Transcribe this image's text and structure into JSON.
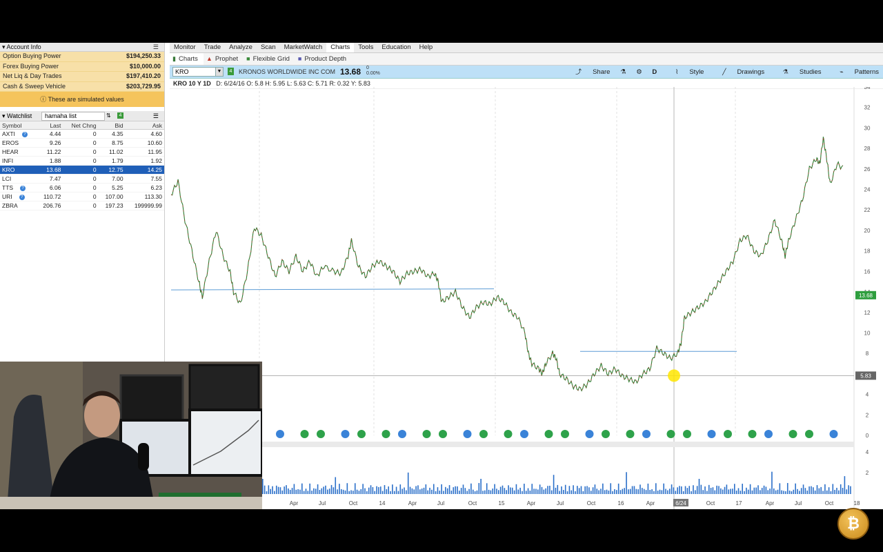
{
  "account": {
    "header": "Account Info",
    "rows": [
      {
        "label": "Option Buying Power",
        "value": "$194,250.33"
      },
      {
        "label": "Forex Buying Power",
        "value": "$10,000.00"
      },
      {
        "label": "Net Liq & Day Trades",
        "value": "$197,410.20"
      },
      {
        "label": "Cash & Sweep Vehicle",
        "value": "$203,729.95"
      }
    ],
    "sim_notice": "These are simulated values"
  },
  "watchlist": {
    "header": "Watchlist",
    "list_name": "hamaha list",
    "columns": [
      "Symbol",
      "Last",
      "Net Chng",
      "Bid",
      "Ask"
    ],
    "rows": [
      {
        "symbol": "AXTI",
        "last": "4.44",
        "chg": "0",
        "bid": "4.35",
        "ask": "4.60",
        "info": true
      },
      {
        "symbol": "EROS",
        "last": "9.26",
        "chg": "0",
        "bid": "8.75",
        "ask": "10.60",
        "info": false
      },
      {
        "symbol": "HEAR",
        "last": "11.22",
        "chg": "0",
        "bid": "11.02",
        "ask": "11.95",
        "info": false
      },
      {
        "symbol": "INFI",
        "last": "1.88",
        "chg": "0",
        "bid": "1.79",
        "ask": "1.92",
        "info": false
      },
      {
        "symbol": "KRO",
        "last": "13.68",
        "chg": "0",
        "bid": "12.75",
        "ask": "14.25",
        "info": false,
        "selected": true
      },
      {
        "symbol": "LCI",
        "last": "7.47",
        "chg": "0",
        "bid": "7.00",
        "ask": "7.55",
        "info": false
      },
      {
        "symbol": "TTS",
        "last": "6.06",
        "chg": "0",
        "bid": "5.25",
        "ask": "6.23",
        "info": true
      },
      {
        "symbol": "URI",
        "last": "110.72",
        "chg": "0",
        "bid": "107.00",
        "ask": "113.30",
        "info": true
      },
      {
        "symbol": "ZBRA",
        "last": "206.76",
        "chg": "0",
        "bid": "197.23",
        "ask": "199999.99",
        "info": false
      }
    ]
  },
  "menu": [
    "Monitor",
    "Trade",
    "Analyze",
    "Scan",
    "MarketWatch",
    "Charts",
    "Tools",
    "Education",
    "Help"
  ],
  "active_menu": "Charts",
  "subtabs": [
    "Charts",
    "Prophet",
    "Flexible Grid",
    "Product Depth"
  ],
  "toolbar": {
    "symbol": "KRO",
    "company": "KRONOS WORLDWIDE INC COM",
    "price": "13.68",
    "change_abs": "0",
    "change_pct": "0.00%",
    "share": "Share",
    "period": "D",
    "style": "Style",
    "drawings": "Drawings",
    "studies": "Studies",
    "patterns": "Patterns"
  },
  "info": {
    "title": "KRO 10 Y 1D",
    "date": "D: 6/24/16",
    "open": "O: 5.8",
    "high": "H: 5.95",
    "low": "L: 5.63",
    "close": "C: 5.71",
    "range": "R: 0.32",
    "y": "Y: 5.83"
  },
  "chart_data": {
    "type": "line",
    "y_ticks": [
      0,
      2,
      4,
      6,
      8,
      10,
      12,
      14,
      16,
      18,
      20,
      22,
      24,
      26,
      28,
      30,
      32,
      34
    ],
    "ylim": [
      0,
      34
    ],
    "x_tick_labels": [
      "Apr",
      "Jul",
      "Oct",
      "14",
      "Apr",
      "Jul",
      "Oct",
      "15",
      "Apr",
      "Jul",
      "Oct",
      "16",
      "Apr",
      "6/24",
      "Oct",
      "17",
      "Apr",
      "Jul",
      "Oct",
      "18"
    ],
    "last_price_label": "13.68",
    "crosshair_label": "5.83",
    "volume_ticks": [
      4,
      2
    ],
    "price_points": [
      [
        0.0,
        23.5
      ],
      [
        0.01,
        24.8
      ],
      [
        0.02,
        21
      ],
      [
        0.03,
        18
      ],
      [
        0.04,
        15
      ],
      [
        0.045,
        13.5
      ],
      [
        0.055,
        17
      ],
      [
        0.065,
        20
      ],
      [
        0.075,
        17.5
      ],
      [
        0.085,
        16
      ],
      [
        0.09,
        14
      ],
      [
        0.1,
        12.8
      ],
      [
        0.11,
        16
      ],
      [
        0.12,
        20.3
      ],
      [
        0.13,
        19.5
      ],
      [
        0.14,
        17.5
      ],
      [
        0.15,
        15.5
      ],
      [
        0.16,
        17
      ],
      [
        0.17,
        16
      ],
      [
        0.18,
        17.5
      ],
      [
        0.19,
        16
      ],
      [
        0.2,
        17
      ],
      [
        0.21,
        15.5
      ],
      [
        0.22,
        16.5
      ],
      [
        0.235,
        16
      ],
      [
        0.245,
        15.8
      ],
      [
        0.255,
        17.5
      ],
      [
        0.26,
        19
      ],
      [
        0.27,
        16.5
      ],
      [
        0.28,
        15.5
      ],
      [
        0.29,
        16.5
      ],
      [
        0.3,
        17
      ],
      [
        0.31,
        16.5
      ],
      [
        0.32,
        16
      ],
      [
        0.33,
        15
      ],
      [
        0.34,
        15.8
      ],
      [
        0.35,
        16
      ],
      [
        0.36,
        16.2
      ],
      [
        0.37,
        15.5
      ],
      [
        0.38,
        15.8
      ],
      [
        0.385,
        15
      ],
      [
        0.39,
        13
      ],
      [
        0.4,
        13.5
      ],
      [
        0.41,
        14
      ],
      [
        0.42,
        12.5
      ],
      [
        0.43,
        11.5
      ],
      [
        0.44,
        12.5
      ],
      [
        0.45,
        13
      ],
      [
        0.46,
        12.8
      ],
      [
        0.47,
        13.5
      ],
      [
        0.48,
        13
      ],
      [
        0.49,
        12
      ],
      [
        0.5,
        11.5
      ],
      [
        0.51,
        10
      ],
      [
        0.515,
        8
      ],
      [
        0.52,
        7
      ],
      [
        0.53,
        6.5
      ],
      [
        0.535,
        6
      ],
      [
        0.54,
        7
      ],
      [
        0.55,
        8
      ],
      [
        0.555,
        7.5
      ],
      [
        0.56,
        6
      ],
      [
        0.57,
        5.5
      ],
      [
        0.58,
        4.8
      ],
      [
        0.59,
        4.5
      ],
      [
        0.6,
        5
      ],
      [
        0.61,
        6
      ],
      [
        0.62,
        6.8
      ],
      [
        0.63,
        6
      ],
      [
        0.64,
        6.5
      ],
      [
        0.65,
        5.8
      ],
      [
        0.66,
        5.5
      ],
      [
        0.67,
        5.2
      ],
      [
        0.68,
        6
      ],
      [
        0.69,
        6.5
      ],
      [
        0.7,
        8.5
      ],
      [
        0.71,
        8
      ],
      [
        0.72,
        7.5
      ],
      [
        0.73,
        8
      ],
      [
        0.735,
        9
      ],
      [
        0.74,
        11.5
      ],
      [
        0.75,
        12
      ],
      [
        0.76,
        12.5
      ],
      [
        0.77,
        13
      ],
      [
        0.78,
        14
      ],
      [
        0.79,
        15
      ],
      [
        0.8,
        16
      ],
      [
        0.81,
        17
      ],
      [
        0.82,
        19
      ],
      [
        0.83,
        19.5
      ],
      [
        0.84,
        18
      ],
      [
        0.85,
        17.5
      ],
      [
        0.86,
        19
      ],
      [
        0.87,
        21
      ],
      [
        0.88,
        19
      ],
      [
        0.885,
        17.5
      ],
      [
        0.89,
        19
      ],
      [
        0.9,
        21
      ],
      [
        0.91,
        23
      ],
      [
        0.92,
        26
      ],
      [
        0.93,
        27
      ],
      [
        0.935,
        26.5
      ],
      [
        0.94,
        29
      ],
      [
        0.945,
        27
      ],
      [
        0.95,
        24.5
      ],
      [
        0.96,
        26.5
      ],
      [
        0.97,
        26
      ]
    ]
  },
  "logo": "₿"
}
